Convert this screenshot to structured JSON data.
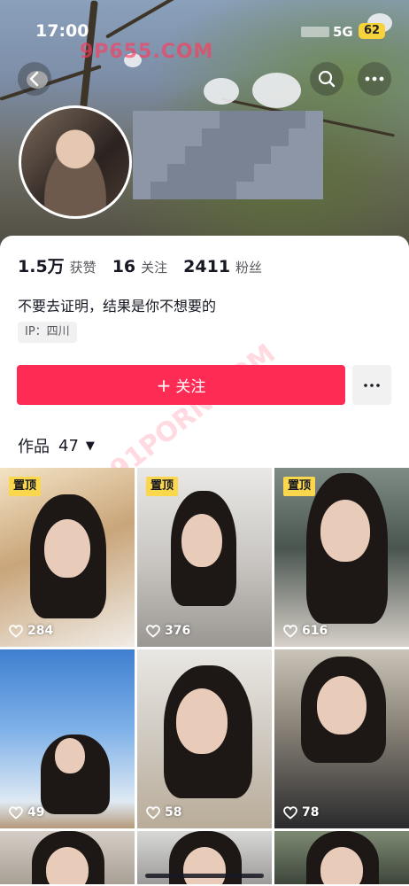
{
  "status_bar": {
    "time": "17:00",
    "network": "5G",
    "battery": "62"
  },
  "watermark": {
    "primary": "9P655.COM",
    "secondary": "91PORN.COM"
  },
  "header": {
    "back_icon": "chevron-left-icon",
    "search_icon": "search-icon",
    "more_icon": "ellipsis-icon"
  },
  "profile": {
    "stats": [
      {
        "value": "1.5万",
        "label": "获赞"
      },
      {
        "value": "16",
        "label": "关注"
      },
      {
        "value": "2411",
        "label": "粉丝"
      }
    ],
    "bio": "不要去证明，结果是你不想要的",
    "ip": "IP：四川"
  },
  "actions": {
    "follow_label": "关注",
    "follow_icon": "plus-icon",
    "more_icon": "ellipsis-icon"
  },
  "works": {
    "label": "作品",
    "count": "47",
    "caret_icon": "caret-down-icon",
    "pinned_label": "置顶",
    "items": [
      {
        "likes": "284",
        "pinned": true
      },
      {
        "likes": "376",
        "pinned": true
      },
      {
        "likes": "616",
        "pinned": true
      },
      {
        "likes": "49",
        "pinned": false
      },
      {
        "likes": "58",
        "pinned": false
      },
      {
        "likes": "78",
        "pinned": false
      }
    ]
  },
  "colors": {
    "accent": "#fe2c55",
    "pin": "#fad74c",
    "text": "#161823",
    "muted": "#57585e"
  }
}
